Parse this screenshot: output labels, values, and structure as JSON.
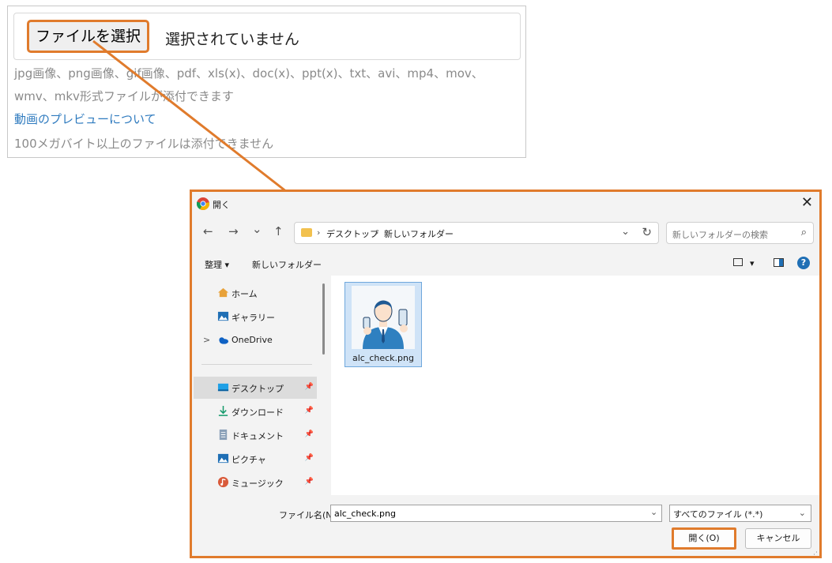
{
  "upload": {
    "choose_label": "ファイルを選択",
    "no_file_text": "選択されていません",
    "hint_line1": "jpg画像、png画像、gif画像、pdf、xls(x)、doc(x)、ppt(x)、txt、avi、mp4、mov、",
    "hint_line2": "wmv、mkv形式ファイルが添付できます",
    "preview_link": "動画のプレビューについて",
    "size_note": "100メガバイト以上のファイルは添付できません"
  },
  "dialog": {
    "title": "開く",
    "close": "✕",
    "nav": {
      "back": "←",
      "forward": "→",
      "recent": "⌄",
      "up": "↑"
    },
    "address": {
      "crumbs": [
        "デスクトップ",
        "新しいフォルダー"
      ],
      "separator": "›",
      "dropdown": "⌄",
      "refresh": "↻"
    },
    "search_placeholder": "新しいフォルダーの検索",
    "search_icon": "⌕",
    "toolbar": {
      "organize": "整理 ▾",
      "new_folder": "新しいフォルダー",
      "view_dropdown": "▾",
      "help": "?"
    },
    "sidebar": {
      "items": [
        {
          "label": "ホーム",
          "icon": "home-icon"
        },
        {
          "label": "ギャラリー",
          "icon": "gallery-icon"
        },
        {
          "label": "OneDrive",
          "icon": "onedrive-icon",
          "expand": ">"
        },
        {
          "label": "デスクトップ",
          "icon": "desktop-icon",
          "pin": "📌"
        },
        {
          "label": "ダウンロード",
          "icon": "download-icon",
          "pin": "📌"
        },
        {
          "label": "ドキュメント",
          "icon": "document-icon",
          "pin": "📌"
        },
        {
          "label": "ピクチャ",
          "icon": "pictures-icon",
          "pin": "📌"
        },
        {
          "label": "ミュージック",
          "icon": "music-icon",
          "pin": "📌"
        }
      ]
    },
    "files": [
      {
        "name": "alc_check.png"
      }
    ],
    "footer": {
      "filename_label": "ファイル名(N):",
      "filename_value": "alc_check.png",
      "filename_dropdown": "⌄",
      "filter": "すべてのファイル (*.*)",
      "filter_dropdown": "⌄",
      "open": "開く(O)",
      "cancel": "キャンセル"
    },
    "colors": {
      "highlight": "#e07b2c",
      "accent": "#1f6fb5",
      "selection": "#cfe3f7"
    }
  }
}
